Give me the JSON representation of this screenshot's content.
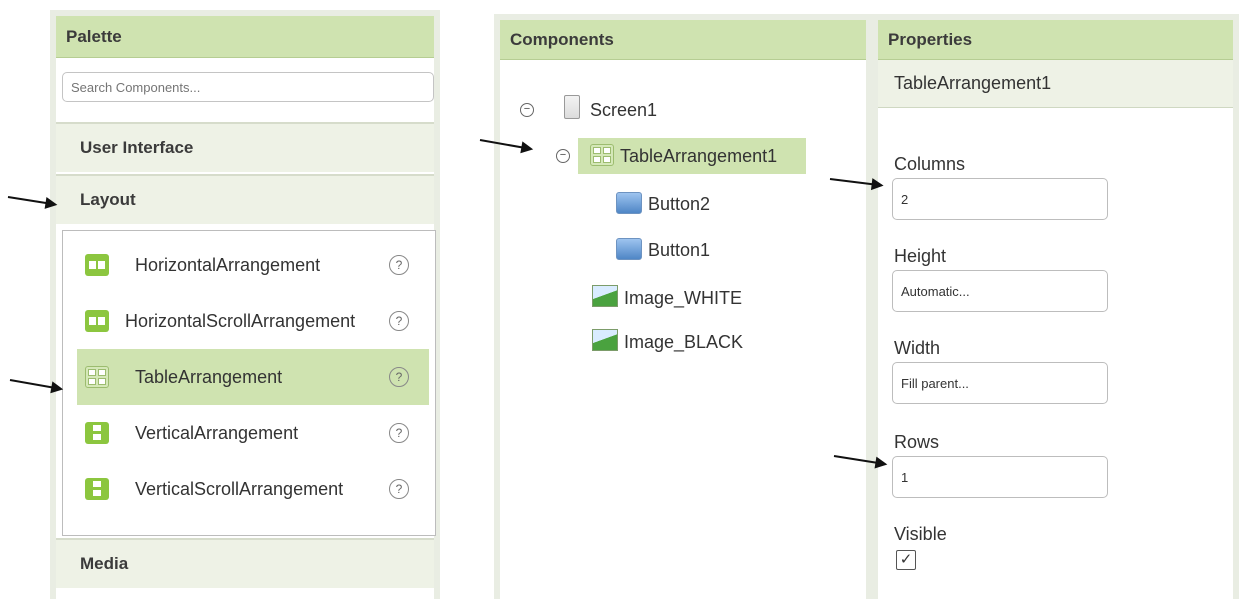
{
  "palette": {
    "title": "Palette",
    "search_placeholder": "Search Components...",
    "categories": {
      "user_interface": "User Interface",
      "layout": "Layout",
      "media": "Media"
    },
    "layout_items": [
      {
        "label": "HorizontalArrangement",
        "icon": "horizontal-arrangement-icon",
        "help": "?"
      },
      {
        "label": "HorizontalScrollArrangement",
        "icon": "horizontal-scroll-arrangement-icon",
        "help": "?"
      },
      {
        "label": "TableArrangement",
        "icon": "table-arrangement-icon",
        "help": "?",
        "selected": true
      },
      {
        "label": "VerticalArrangement",
        "icon": "vertical-arrangement-icon",
        "help": "?"
      },
      {
        "label": "VerticalScrollArrangement",
        "icon": "vertical-scroll-arrangement-icon",
        "help": "?"
      }
    ]
  },
  "components": {
    "title": "Components",
    "tree": [
      {
        "label": "Screen1",
        "icon": "screen-icon",
        "toggle": "−"
      },
      {
        "label": "TableArrangement1",
        "icon": "table-arrangement-icon",
        "toggle": "−",
        "selected": true
      },
      {
        "label": "Button2",
        "icon": "button-icon"
      },
      {
        "label": "Button1",
        "icon": "button-icon"
      },
      {
        "label": "Image_WHITE",
        "icon": "image-icon"
      },
      {
        "label": "Image_BLACK",
        "icon": "image-icon"
      }
    ]
  },
  "properties": {
    "title": "Properties",
    "component_name": "TableArrangement1",
    "columns_label": "Columns",
    "columns_value": "2",
    "height_label": "Height",
    "height_value": "Automatic...",
    "width_label": "Width",
    "width_value": "Fill parent...",
    "rows_label": "Rows",
    "rows_value": "1",
    "visible_label": "Visible",
    "visible_checked": true,
    "check_glyph": "✓"
  },
  "colors": {
    "header_green": "#cfe3b0",
    "selected_green": "#cfe3b0",
    "category_bg": "#eef2e6"
  }
}
